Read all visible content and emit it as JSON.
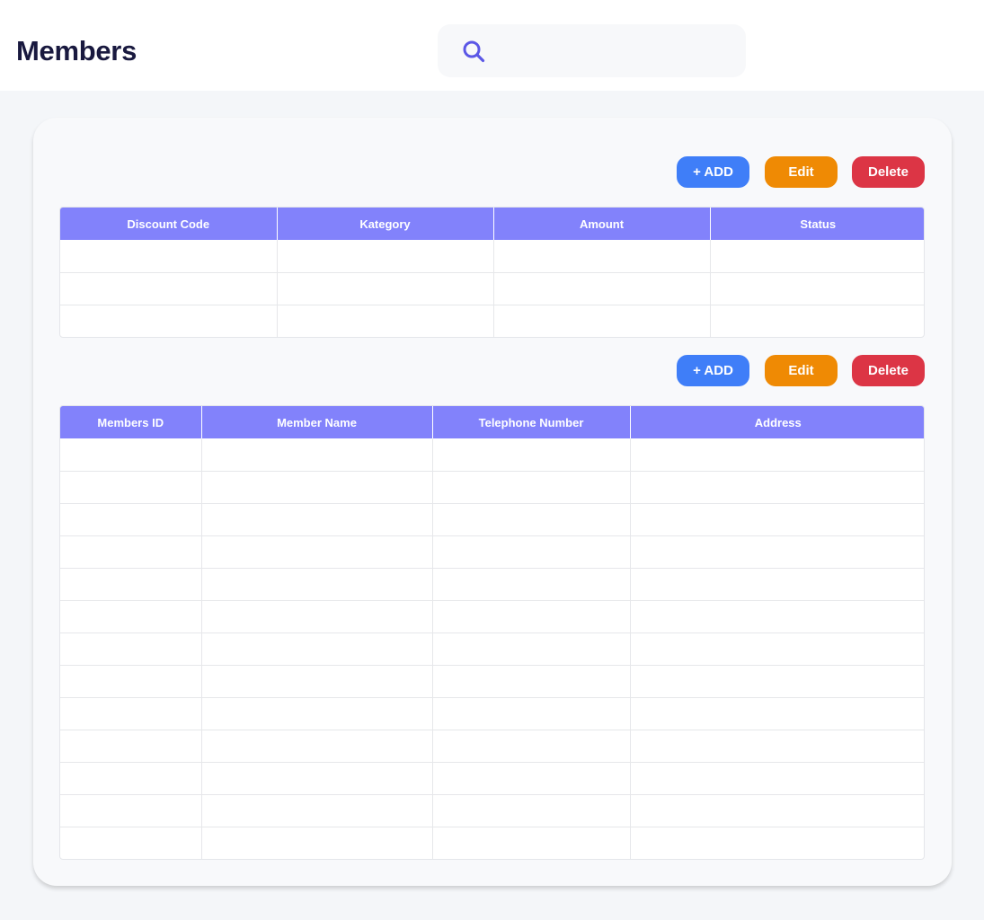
{
  "header": {
    "title": "Members",
    "search": {
      "placeholder": "",
      "value": ""
    }
  },
  "discount_section": {
    "buttons": {
      "add": "+ ADD",
      "edit": "Edit",
      "delete": "Delete"
    },
    "columns": [
      "Discount Code",
      "Kategory",
      "Amount",
      "Status"
    ],
    "rows": [
      [
        "",
        "",
        "",
        ""
      ],
      [
        "",
        "",
        "",
        ""
      ],
      [
        "",
        "",
        "",
        ""
      ]
    ]
  },
  "members_section": {
    "buttons": {
      "add": "+ ADD",
      "edit": "Edit",
      "delete": "Delete"
    },
    "columns": [
      "Members ID",
      "Member Name",
      "Telephone Number",
      "Address"
    ],
    "rows": [
      [
        "",
        "",
        "",
        ""
      ],
      [
        "",
        "",
        "",
        ""
      ],
      [
        "",
        "",
        "",
        ""
      ],
      [
        "",
        "",
        "",
        ""
      ],
      [
        "",
        "",
        "",
        ""
      ],
      [
        "",
        "",
        "",
        ""
      ],
      [
        "",
        "",
        "",
        ""
      ],
      [
        "",
        "",
        "",
        ""
      ],
      [
        "",
        "",
        "",
        ""
      ],
      [
        "",
        "",
        "",
        ""
      ],
      [
        "",
        "",
        "",
        ""
      ],
      [
        "",
        "",
        "",
        ""
      ],
      [
        "",
        "",
        "",
        ""
      ]
    ]
  },
  "colors": {
    "title": "#19193f",
    "add": "#3f7ef8",
    "edit": "#ef8a04",
    "delete": "#dc3545",
    "table_header": "#8282fb"
  }
}
